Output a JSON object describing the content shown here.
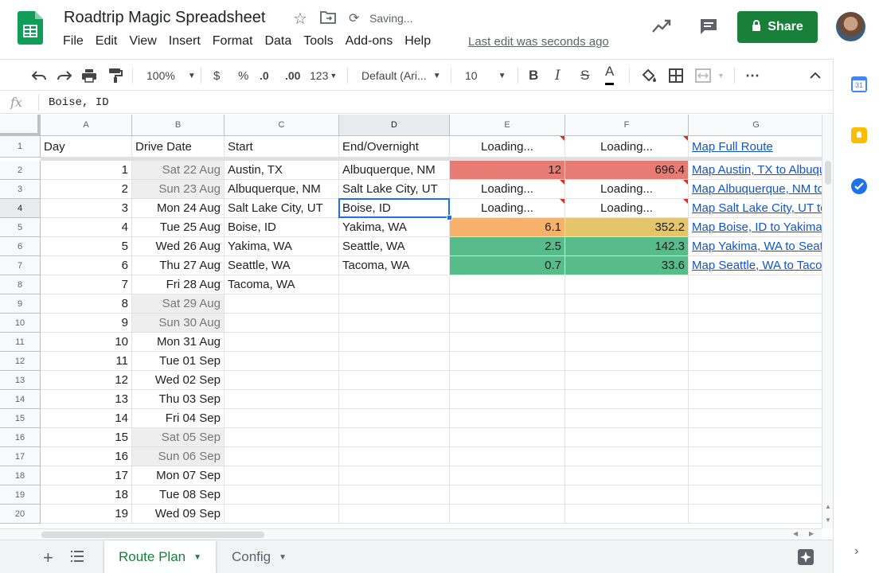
{
  "doc": {
    "title": "Roadtrip Magic Spreadsheet",
    "status": "Saving...",
    "last_edit": "Last edit was seconds ago"
  },
  "menu": [
    "File",
    "Edit",
    "View",
    "Insert",
    "Format",
    "Data",
    "Tools",
    "Add-ons",
    "Help"
  ],
  "share_label": "Share",
  "toolbar": {
    "zoom": "100%",
    "currency": "$",
    "percent": "%",
    "dec_less": ".0",
    "dec_more": ".00",
    "more_formats": "123",
    "font": "Default (Ari...",
    "font_size": "10",
    "bold": "B",
    "italic": "I",
    "strike": "S",
    "text_color": "A"
  },
  "formula": {
    "fx": "fx",
    "value": "Boise, ID"
  },
  "columns": [
    "A",
    "B",
    "C",
    "D",
    "E",
    "F",
    "G"
  ],
  "rows": [
    [
      "Day",
      "Drive Date",
      "Start",
      "End/Overnight",
      "Loading...",
      "Loading...",
      "Map Full Route"
    ],
    [
      "1",
      "Sat 22 Aug",
      "Austin, TX",
      "Albuquerque, NM",
      "12",
      "696.4",
      "Map Austin, TX to Albuquerque, NM"
    ],
    [
      "2",
      "Sun 23 Aug",
      "Albuquerque, NM",
      "Salt Lake City, UT",
      "Loading...",
      "Loading...",
      "Map Albuquerque, NM to Salt Lake City, UT"
    ],
    [
      "3",
      "Mon 24 Aug",
      "Salt Lake City, UT",
      "Boise, ID",
      "Loading...",
      "Loading...",
      "Map Salt Lake City, UT to Boise, ID"
    ],
    [
      "4",
      "Tue 25 Aug",
      "Boise, ID",
      "Yakima, WA",
      "6.1",
      "352.2",
      "Map Boise, ID to Yakima, WA"
    ],
    [
      "5",
      "Wed 26 Aug",
      "Yakima, WA",
      "Seattle, WA",
      "2.5",
      "142.3",
      "Map Yakima, WA to Seattle, WA"
    ],
    [
      "6",
      "Thu 27 Aug",
      "Seattle, WA",
      "Tacoma, WA",
      "0.7",
      "33.6",
      "Map Seattle, WA to Tacoma, WA"
    ],
    [
      "7",
      "Fri 28 Aug",
      "Tacoma, WA",
      "",
      "",
      "",
      ""
    ],
    [
      "8",
      "Sat 29 Aug",
      "",
      "",
      "",
      "",
      ""
    ],
    [
      "9",
      "Sun 30 Aug",
      "",
      "",
      "",
      "",
      ""
    ],
    [
      "10",
      "Mon 31 Aug",
      "",
      "",
      "",
      "",
      ""
    ],
    [
      "11",
      "Tue 01 Sep",
      "",
      "",
      "",
      "",
      ""
    ],
    [
      "12",
      "Wed 02 Sep",
      "",
      "",
      "",
      "",
      ""
    ],
    [
      "13",
      "Thu 03 Sep",
      "",
      "",
      "",
      "",
      ""
    ],
    [
      "14",
      "Fri 04 Sep",
      "",
      "",
      "",
      "",
      ""
    ],
    [
      "15",
      "Sat 05 Sep",
      "",
      "",
      "",
      "",
      ""
    ],
    [
      "16",
      "Sun 06 Sep",
      "",
      "",
      "",
      "",
      ""
    ],
    [
      "17",
      "Mon 07 Sep",
      "",
      "",
      "",
      "",
      ""
    ],
    [
      "18",
      "Tue 08 Sep",
      "",
      "",
      "",
      "",
      ""
    ],
    [
      "19",
      "Wed 09 Sep",
      "",
      "",
      "",
      "",
      ""
    ]
  ],
  "cell_colors": {
    "1": {
      "4": "#e67c73",
      "5": "#e67c73"
    },
    "4": {
      "4": "#f6b26b",
      "5": "#e5c56c"
    },
    "5": {
      "4": "#57bb8a",
      "5": "#57bb8a"
    },
    "6": {
      "4": "#57bb8a",
      "5": "#57bb8a"
    }
  },
  "weekend_rows": [
    1,
    2,
    8,
    9,
    15,
    16
  ],
  "selected_cell": "D4",
  "sheets": [
    {
      "name": "Route Plan",
      "active": true
    },
    {
      "name": "Config",
      "active": false
    }
  ],
  "colors": {
    "brand_green": "#188038",
    "selection": "#1a73e8",
    "link": "#1155cc"
  }
}
